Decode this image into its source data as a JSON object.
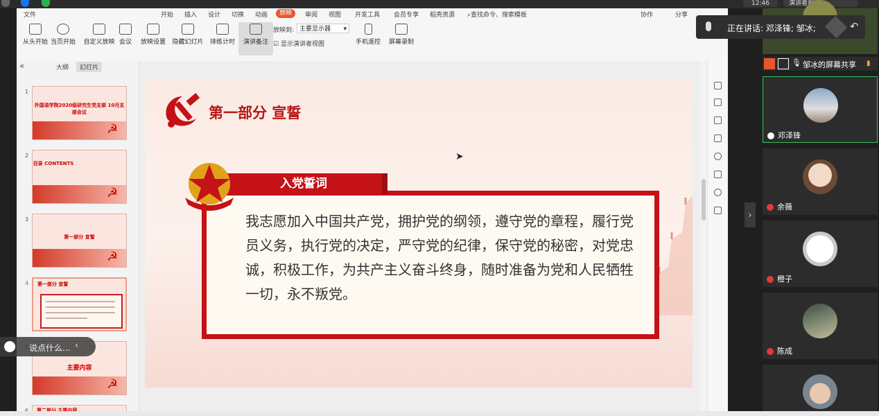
{
  "system": {
    "clock": "12:46",
    "presenter_view": "演讲者视图"
  },
  "menubar": {
    "file": "文件",
    "menus": [
      "开始",
      "插入",
      "设计",
      "切换",
      "动画",
      "放映",
      "审阅",
      "视图",
      "开发工具",
      "会员专享",
      "稻壳资源"
    ],
    "active_menu": "放映",
    "search_placeholder": "查找命令、搜索模板",
    "collab": "协作",
    "share": "分享"
  },
  "ribbon": {
    "buttons": [
      "从头开始",
      "当页开始",
      "自定义放映",
      "会议",
      "放映设置",
      "隐藏幻灯片",
      "排练计时",
      "演讲备注",
      "手机遥控",
      "屏幕录制"
    ],
    "display_to_label": "放映到:",
    "display_to_value": "主要显示器",
    "show_presenter_view": "显示演讲者视图"
  },
  "sidepanel": {
    "tabs": [
      "大纲",
      "幻灯片"
    ],
    "active_tab": "幻灯片",
    "thumbs": [
      {
        "num": "1",
        "title": "外国语学院2020级研究生党支部\n10月支部会议"
      },
      {
        "num": "2",
        "title": "目录 CONTENTS"
      },
      {
        "num": "3",
        "title": "第一部分 宣誓"
      },
      {
        "num": "4",
        "title": "第一部分 宣誓"
      },
      {
        "num": "5",
        "title": "主要内容"
      },
      {
        "num": "6",
        "title": "第二部分 主要内容"
      }
    ]
  },
  "slide": {
    "title": "第一部分 宣誓",
    "label": "入党誓词",
    "oath": "我志愿加入中国共产党，拥护党的纲领，遵守党的章程，履行党员义务，执行党的决定，严守党的纪律，保守党的秘密，对党忠诚，积极工作，为共产主义奋斗终身，随时准备为党和人民牺牲一切，永不叛党。"
  },
  "meeting": {
    "speaking": "正在讲话: 邓泽锋; 邹冰;",
    "screen_share": "邹冰的屏幕共享",
    "participants": [
      "邓泽锋",
      "余薇",
      "橙子",
      "陈成"
    ]
  },
  "comment": {
    "placeholder": "说点什么..."
  },
  "colors": {
    "accent": "#e8572c",
    "party_red": "#c41217",
    "slide_bg": "#fbeae4"
  }
}
